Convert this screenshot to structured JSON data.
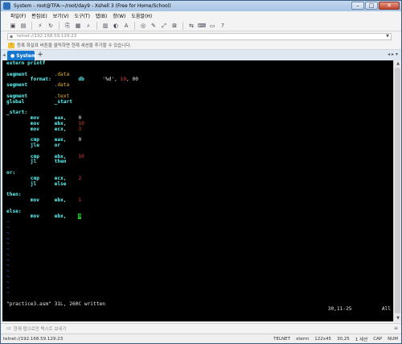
{
  "window": {
    "title": "System - root@TFA:~/root/day9 - Xshell 3 (Free for Home/School)"
  },
  "menu": [
    "파일(F)",
    "편집(E)",
    "보기(V)",
    "도구(T)",
    "탭(B)",
    "창(W)",
    "도움말(H)"
  ],
  "toolbar_icons": [
    "new-session-icon",
    "open-folder-icon",
    "disconnect-icon",
    "reconnect-icon",
    "copy-icon",
    "paste-icon",
    "find-icon",
    "print-icon",
    "color-scheme-icon",
    "font-icon",
    "globe-icon",
    "script-icon",
    "fullscreen-icon",
    "lock-icon",
    "transfer-icon",
    "keyboard-icon",
    "compose-icon",
    "help-icon"
  ],
  "address": {
    "value": "telnet://192.168.59.129:23"
  },
  "infobar": {
    "text": "등록 화살표 버튼을 클릭하면 현재 세션을 추가할 수 있습니다."
  },
  "tabs": [
    {
      "label": "System",
      "active": true
    }
  ],
  "terminal": {
    "lines": [
      [
        {
          "t": "extern printf",
          "c": "c-lbl"
        }
      ],
      [],
      [
        {
          "t": "segment",
          "c": "c-kw"
        },
        {
          "t": "         ",
          "c": ""
        },
        {
          "t": ".data",
          "c": "c-yellow"
        }
      ],
      [
        {
          "t": "        format:",
          "c": "c-kw"
        },
        {
          "t": "         ",
          "c": ""
        },
        {
          "t": "db",
          "c": "c-kw"
        },
        {
          "t": "      ",
          "c": ""
        },
        {
          "t": "'%d'",
          "c": "c-white"
        },
        {
          "t": ", ",
          "c": "c-white"
        },
        {
          "t": "10",
          "c": "c-red"
        },
        {
          "t": ", 00",
          "c": "c-white"
        }
      ],
      [
        {
          "t": "segment",
          "c": "c-kw"
        },
        {
          "t": "         ",
          "c": ""
        },
        {
          "t": ".data",
          "c": "c-yellow"
        }
      ],
      [],
      [
        {
          "t": "segment",
          "c": "c-kw"
        },
        {
          "t": "         ",
          "c": ""
        },
        {
          "t": ".text",
          "c": "c-yellow"
        }
      ],
      [
        {
          "t": "global",
          "c": "c-kw"
        },
        {
          "t": "          ",
          "c": ""
        },
        {
          "t": "_start",
          "c": "c-kw"
        }
      ],
      [],
      [
        {
          "t": "_start:",
          "c": "c-lbl"
        }
      ],
      [
        {
          "t": "        mov",
          "c": "c-kw"
        },
        {
          "t": "     ",
          "c": ""
        },
        {
          "t": "eax,",
          "c": "c-kw"
        },
        {
          "t": "    ",
          "c": ""
        },
        {
          "t": "0",
          "c": "c-white"
        }
      ],
      [
        {
          "t": "        mov",
          "c": "c-kw"
        },
        {
          "t": "     ",
          "c": ""
        },
        {
          "t": "ebx,",
          "c": "c-kw"
        },
        {
          "t": "    ",
          "c": ""
        },
        {
          "t": "10",
          "c": "c-red"
        }
      ],
      [
        {
          "t": "        mov",
          "c": "c-kw"
        },
        {
          "t": "     ",
          "c": ""
        },
        {
          "t": "ecx,",
          "c": "c-kw"
        },
        {
          "t": "    ",
          "c": ""
        },
        {
          "t": "3",
          "c": "c-red"
        }
      ],
      [],
      [
        {
          "t": "        cmp",
          "c": "c-kw"
        },
        {
          "t": "     ",
          "c": ""
        },
        {
          "t": "eax,",
          "c": "c-kw"
        },
        {
          "t": "    ",
          "c": ""
        },
        {
          "t": "0",
          "c": "c-white"
        }
      ],
      [
        {
          "t": "        jle",
          "c": "c-kw"
        },
        {
          "t": "     ",
          "c": ""
        },
        {
          "t": "or",
          "c": "c-kw"
        }
      ],
      [],
      [
        {
          "t": "        cmp",
          "c": "c-kw"
        },
        {
          "t": "     ",
          "c": ""
        },
        {
          "t": "ebx,",
          "c": "c-kw"
        },
        {
          "t": "    ",
          "c": ""
        },
        {
          "t": "10",
          "c": "c-red"
        }
      ],
      [
        {
          "t": "        jl",
          "c": "c-kw"
        },
        {
          "t": "      ",
          "c": ""
        },
        {
          "t": "then",
          "c": "c-kw"
        }
      ],
      [],
      [
        {
          "t": "or:",
          "c": "c-lbl"
        }
      ],
      [
        {
          "t": "        cmp",
          "c": "c-kw"
        },
        {
          "t": "     ",
          "c": ""
        },
        {
          "t": "ecx,",
          "c": "c-kw"
        },
        {
          "t": "    ",
          "c": ""
        },
        {
          "t": "2",
          "c": "c-red"
        }
      ],
      [
        {
          "t": "        jl",
          "c": "c-kw"
        },
        {
          "t": "      ",
          "c": ""
        },
        {
          "t": "else",
          "c": "c-kw"
        }
      ],
      [],
      [
        {
          "t": "then:",
          "c": "c-lbl"
        }
      ],
      [
        {
          "t": "        mov",
          "c": "c-kw"
        },
        {
          "t": "     ",
          "c": ""
        },
        {
          "t": "ebx,",
          "c": "c-kw"
        },
        {
          "t": "    ",
          "c": ""
        },
        {
          "t": "1",
          "c": "c-red"
        }
      ],
      [],
      [
        {
          "t": "else:",
          "c": "c-lbl"
        }
      ],
      [
        {
          "t": "        mov",
          "c": "c-kw"
        },
        {
          "t": "     ",
          "c": ""
        },
        {
          "t": "ebx,",
          "c": "c-kw"
        },
        {
          "t": "    ",
          "c": ""
        },
        {
          "t": "0",
          "c": "cursor"
        }
      ],
      [
        {
          "t": "~",
          "c": "c-blue"
        }
      ],
      [
        {
          "t": "~",
          "c": "c-blue"
        }
      ],
      [
        {
          "t": "~",
          "c": "c-blue"
        }
      ],
      [
        {
          "t": "~",
          "c": "c-blue"
        }
      ],
      [
        {
          "t": "~",
          "c": "c-blue"
        }
      ],
      [
        {
          "t": "~",
          "c": "c-blue"
        }
      ],
      [
        {
          "t": "~",
          "c": "c-blue"
        }
      ],
      [
        {
          "t": "~",
          "c": "c-blue"
        }
      ],
      [
        {
          "t": "~",
          "c": "c-blue"
        }
      ],
      [
        {
          "t": "~",
          "c": "c-blue"
        }
      ],
      [
        {
          "t": "~",
          "c": "c-blue"
        }
      ],
      [
        {
          "t": "~",
          "c": "c-blue"
        }
      ],
      [
        {
          "t": "~",
          "c": "c-blue"
        }
      ],
      [
        {
          "t": "~",
          "c": "c-blue"
        }
      ]
    ],
    "status_left": "\"practice3.asm\" 31L, 260C written",
    "status_pos": "30,11-25",
    "status_right": "All"
  },
  "sendbar": {
    "placeholder": "현재 탭으로만 텍스트 보내기"
  },
  "statusbar": {
    "connection": "telnet://192.168.59.129:23",
    "protocol": "TELNET",
    "term": "xterm",
    "size": "122x45",
    "cursor": "30,25",
    "sessions": "1 세션",
    "cap": "CAP",
    "num": "NUM"
  }
}
